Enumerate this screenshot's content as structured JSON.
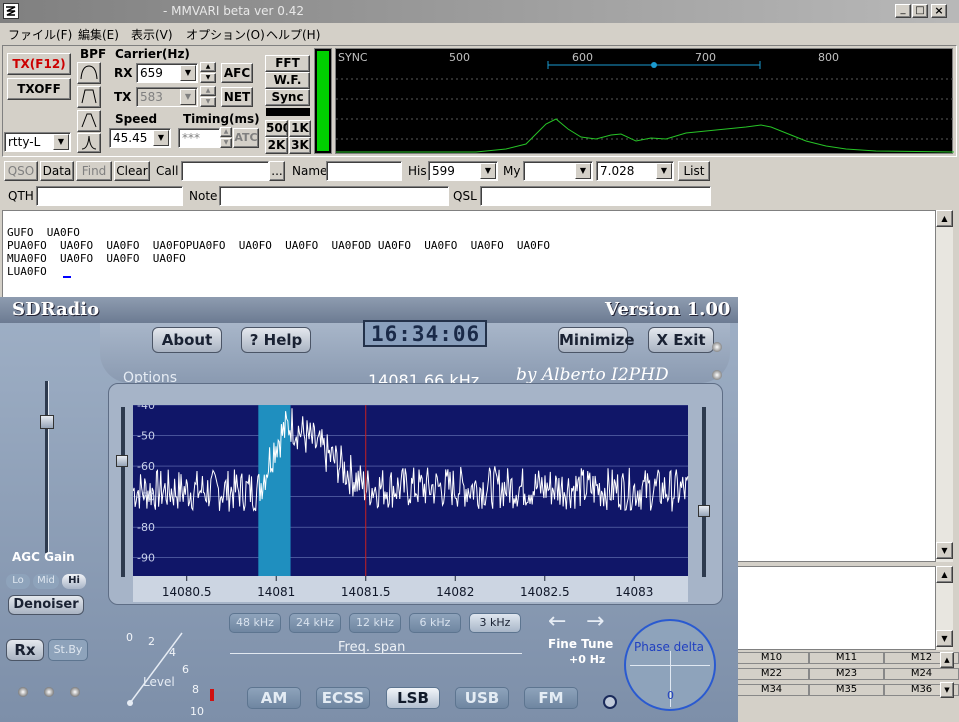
{
  "window": {
    "title": "- MMVARI beta ver 0.42"
  },
  "menu": [
    "ファイル(F)",
    "編集(E)",
    "表示(V)",
    "オプション(O)",
    "ヘルプ(H)"
  ],
  "tx": {
    "tx_label": "TX(F12)",
    "txoff_label": "TXOFF",
    "mode_value": "rtty-L",
    "bpf_label": "BPF"
  },
  "carrier": {
    "title": "Carrier(Hz)",
    "rx_label": "RX",
    "rx_value": "659",
    "tx_label": "TX",
    "tx_value": "583",
    "afc_label": "AFC",
    "net_label": "NET"
  },
  "speed": {
    "title": "Speed",
    "value": "45.45",
    "timing_title": "Timing(ms)",
    "timing_value": "***",
    "atc_label": "ATC"
  },
  "view_buttons": {
    "fft": "FFT",
    "wf": "W.F.",
    "sync": "Sync",
    "b500": "500",
    "b1k": "1K",
    "b2k": "2K",
    "b3k": "3K"
  },
  "spectrum": {
    "sync_label": "SYNC",
    "ticks": [
      "500",
      "600",
      "700",
      "800"
    ]
  },
  "log": {
    "qso": "QSO",
    "data": "Data",
    "find": "Find",
    "clear": "Clear",
    "call_label": "Call",
    "ellipsis": "...",
    "name_label": "Name",
    "his_label": "His",
    "his_value": "599",
    "my_label": "My",
    "freq_value": "7.028",
    "list": "List",
    "qth_label": "QTH",
    "note_label": "Note",
    "qsl_label": "QSL"
  },
  "rx_text": [
    "GUFO  UA0FO",
    "PUA0FO  UA0FO  UA0FO  UA0FOPUA0FO  UA0FO  UA0FO  UA0FOD UA0FO  UA0FO  UA0FO  UA0FO",
    "MUA0FO  UA0FO  UA0FO  UA0FO",
    "LUA0FO  "
  ],
  "macro_grid": [
    [
      "M10",
      "M11",
      "M12"
    ],
    [
      "M22",
      "M23",
      "M24"
    ],
    [
      "M34",
      "M35",
      "M36"
    ]
  ],
  "sdr": {
    "title": "SDRadio",
    "version": "Version 1.00",
    "about": "About",
    "help": "? Help",
    "clock": "16:34:06",
    "minimize": "Minimize",
    "exit": "X Exit",
    "options": "Options",
    "frequency": "14081.66 kHz",
    "author": "by Alberto I2PHD",
    "y_ticks": [
      "-40",
      "-50",
      "-60",
      "-70",
      "-80",
      "-90"
    ],
    "x_ticks": [
      "14080.5",
      "14081",
      "14081.5",
      "14082",
      "14082.5",
      "14083"
    ],
    "agc_gain": "AGC Gain",
    "agc_lo": "Lo",
    "agc_mid": "Mid",
    "agc_hi": "Hi",
    "denoiser": "Denoiser",
    "rx": "Rx",
    "stby": "St.By",
    "span_buttons": [
      "48 kHz",
      "24 kHz",
      "12 kHz",
      "6 kHz",
      "3 kHz"
    ],
    "freq_span": "Freq. span",
    "fine_tune": "Fine Tune",
    "fine_tune_value": "+0 Hz",
    "phase_delta": "Phase delta",
    "phase_value": "0",
    "level_label": "Level",
    "level_ticks": [
      "0",
      "2",
      "4",
      "6",
      "8",
      "10"
    ],
    "modes": [
      "AM",
      "ECSS",
      "LSB",
      "USB",
      "FM"
    ],
    "active_mode": "LSB"
  },
  "colors": {
    "spectrum_bg": "#000000",
    "spectrum_line": "#27c427",
    "sdr_plot_bg": "#101668",
    "sdr_signal": "#ffffff",
    "sdr_marker": "#c82020",
    "sdr_passband": "#1f8fbf",
    "tx_text": "#cc0000",
    "sdr_frame": "#8798b0"
  },
  "chart_data": {
    "type": "line",
    "title": "",
    "xlabel": "",
    "ylabel": "",
    "x_ticks": [
      "14080.5",
      "14081",
      "14081.5",
      "14082",
      "14082.5",
      "14083"
    ],
    "y_ticks": [
      "-40",
      "-50",
      "-60",
      "-70",
      "-80",
      "-90"
    ],
    "xlim": [
      14080.2,
      14083.3
    ],
    "ylim": [
      -96,
      -40
    ],
    "passband": [
      14080.9,
      14081.08
    ],
    "tuned_frequency": 14081.5,
    "series": [
      {
        "values_note": "noise floor",
        "x": [
          14080.2,
          14080.9,
          14081.0,
          14081.08,
          14081.5,
          14082.0,
          14082.5,
          14083.3
        ],
        "y": [
          -68,
          -68,
          -52,
          -46,
          -67,
          -67,
          -67,
          -68
        ]
      }
    ]
  }
}
